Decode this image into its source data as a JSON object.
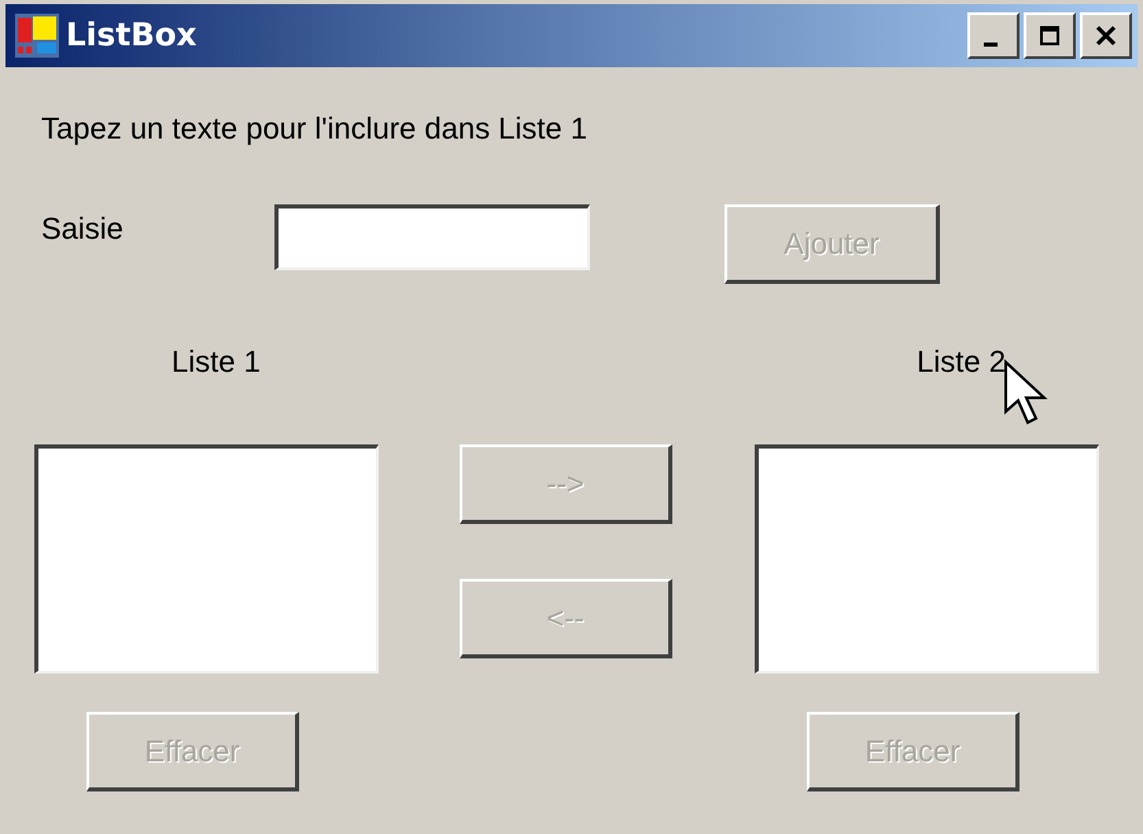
{
  "window": {
    "title": "ListBox"
  },
  "instruction": "Tapez un texte pour l'inclure dans Liste 1",
  "input": {
    "label": "Saisie"
  },
  "add_button": {
    "label": "Ajouter",
    "disabled": true
  },
  "lists": [
    {
      "label": "Liste 1"
    },
    {
      "label": "Liste 2"
    }
  ],
  "move_buttons": [
    {
      "label": "-->",
      "disabled": true
    },
    {
      "label": "<--",
      "disabled": true
    }
  ],
  "clear_buttons": [
    {
      "label": "Effacer",
      "disabled": true
    },
    {
      "label": "Effacer",
      "disabled": true
    }
  ]
}
